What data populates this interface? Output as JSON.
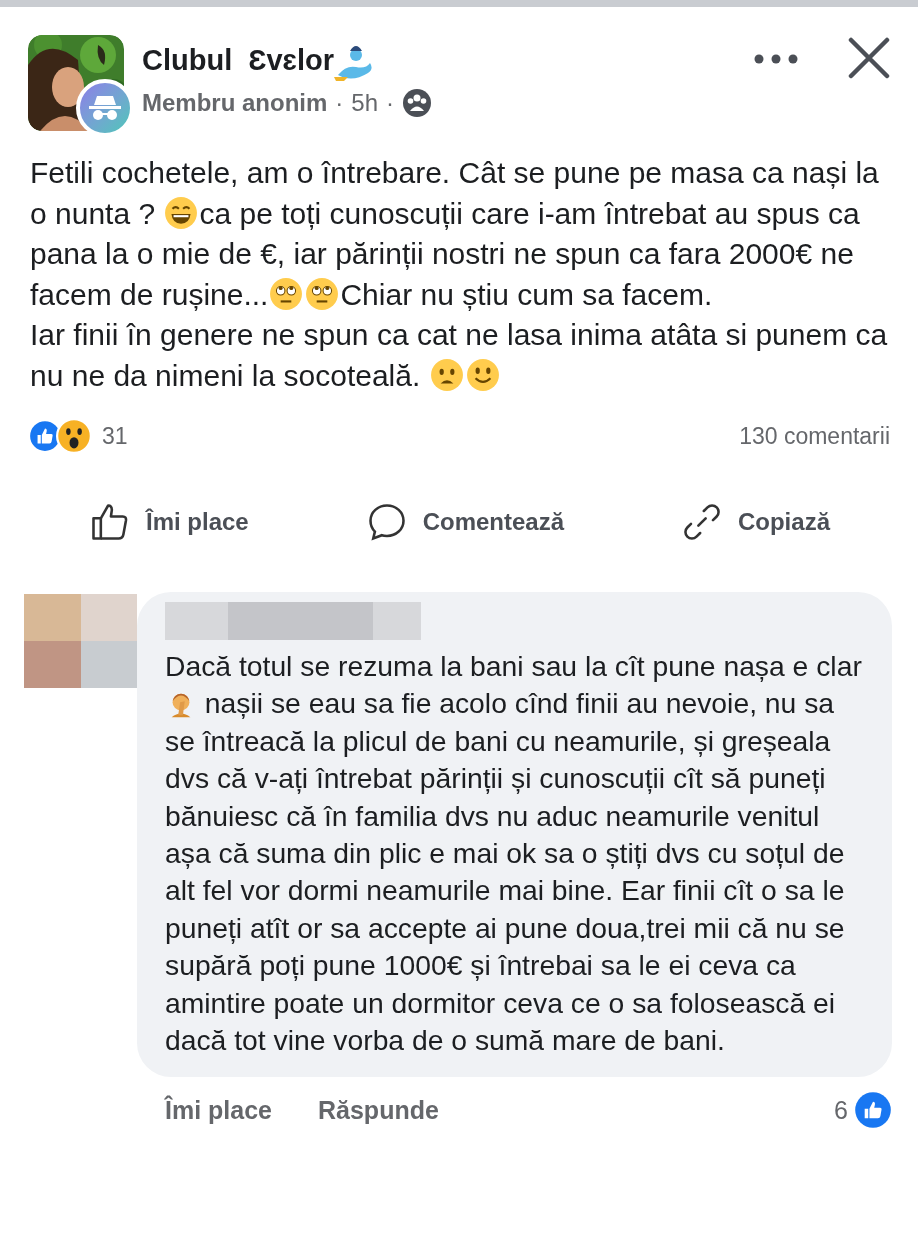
{
  "post": {
    "group_name": "Clubul  Ɛvɛlor",
    "author": "Membru anonim",
    "separator_1": "·",
    "time": "5h",
    "separator_2": "·",
    "paragraphs": [
      [
        {
          "kind": "text",
          "text": "Fetili cochetele, am o întrebare. Cât se pune pe masa ca nași la o nunta ? "
        },
        {
          "kind": "grin"
        },
        {
          "kind": "text",
          "text": "ca pe toți cunoscuții care i-am întrebat au spus ca pana la o mie de €, iar părinții nostri ne spun ca fara 2000€ ne facem de rușine..."
        },
        {
          "kind": "eyeroll"
        },
        {
          "kind": "eyeroll"
        },
        {
          "kind": "text",
          "text": "Chiar nu știu cum sa facem."
        }
      ],
      [
        {
          "kind": "text",
          "text": "Iar finii în genere ne spun ca cat ne lasa inima atâta si punem ca nu ne da nimeni la socoteală. "
        },
        {
          "kind": "worried"
        },
        {
          "kind": "smile"
        }
      ]
    ],
    "reaction_count": "31",
    "comment_count": "130 comentarii",
    "actions": [
      {
        "kind": "like",
        "label": "Îmi place"
      },
      {
        "kind": "comment",
        "label": "Comentează"
      },
      {
        "kind": "copy",
        "label": "Copiază"
      }
    ]
  },
  "comment": {
    "segments": [
      {
        "kind": "text",
        "text": "Dacă totul se rezuma la bani sau la cît pune nașa e clar "
      },
      {
        "kind": "facepalm"
      },
      {
        "kind": "text",
        "text": " nașii se eau sa fie acolo cînd finii au nevoie, nu sa se întreacă la plicul de bani cu neamurile, și greșeala dvs că v-ați întrebat părinții și cunoscuții cît să puneți bănuiesc că în familia dvs nu aduc neamurile venitul așa că suma din plic e mai ok sa o știți dvs cu soțul de alt fel vor dormi neamurile mai bine. Ear finii cît o sa le puneți atît or sa accepte ai pune doua,trei mii că nu se supără poți pune 1000€ și întrebai sa le ei ceva ca amintire poate un dormitor ceva ce o sa folosească ei dacă tot vine vorba de o sumă mare de bani."
      }
    ],
    "like_label": "Îmi place",
    "reply_label": "Răspunde",
    "like_count": "6"
  }
}
